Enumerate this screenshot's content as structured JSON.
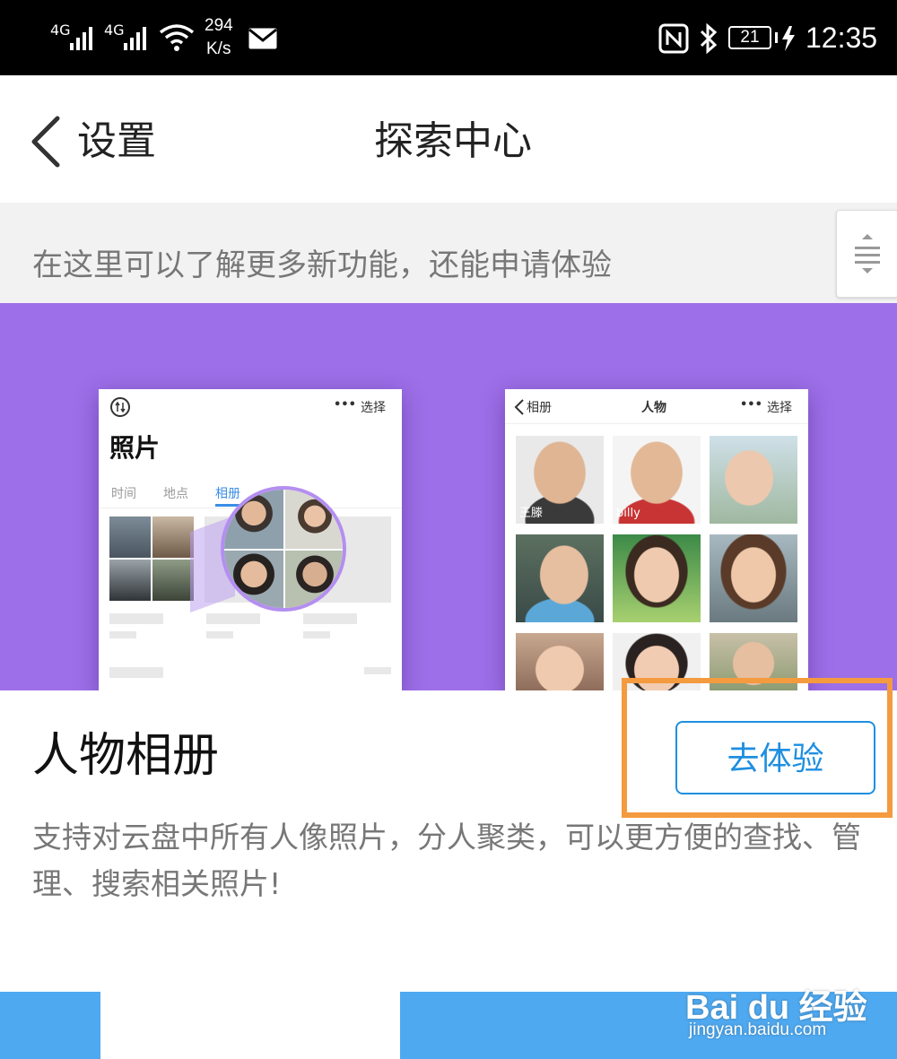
{
  "status_bar": {
    "network1": "4G",
    "network2": "4G",
    "speed_value": "294",
    "speed_unit": "K/s",
    "battery": "21",
    "time": "12:35"
  },
  "nav": {
    "back_label": "设置",
    "title": "探索中心"
  },
  "intro": {
    "text": "在这里可以了解更多新功能，还能申请体验"
  },
  "hero": {
    "background": "#9d6fe8",
    "left_phone": {
      "title": "照片",
      "menu_dots": "•••",
      "select": "选择",
      "tabs": [
        {
          "label": "时间",
          "active": false
        },
        {
          "label": "地点",
          "active": false
        },
        {
          "label": "相册",
          "active": true
        }
      ]
    },
    "right_phone": {
      "back": "相册",
      "title": "人物",
      "menu_dots": "•••",
      "select": "选择",
      "names": [
        "王滕",
        "billy"
      ]
    }
  },
  "feature": {
    "title": "人物相册",
    "button_label": "去体验",
    "description": "支持对云盘中所有人像照片，分人聚类，可以更方便的查找、管理、搜索相关照片!",
    "accent_color": "#1e8fe0",
    "highlight_color": "#f49a3f"
  },
  "watermark": {
    "brand": "Bai du 经验",
    "url": "jingyan.baidu.com"
  }
}
